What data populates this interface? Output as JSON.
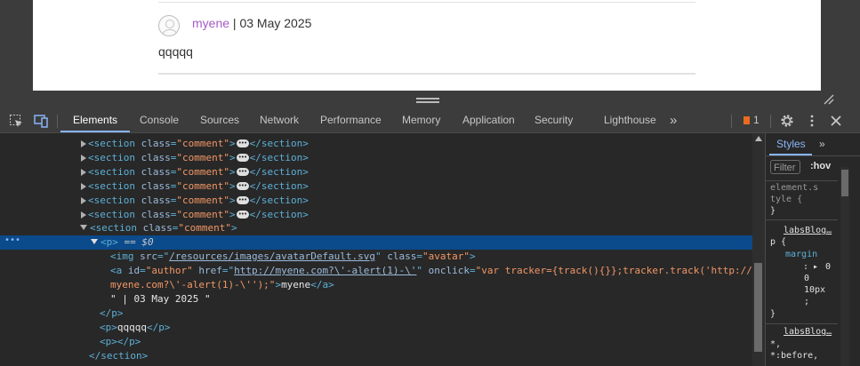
{
  "page": {
    "comment": {
      "author": "myene",
      "separator": " | ",
      "date": "03 May 2025",
      "text": "qqqqq"
    }
  },
  "devtools": {
    "tabs": [
      {
        "label": "Elements",
        "active": true
      },
      {
        "label": "Console"
      },
      {
        "label": "Sources"
      },
      {
        "label": "Network"
      },
      {
        "label": "Performance"
      },
      {
        "label": "Memory"
      },
      {
        "label": "Application"
      },
      {
        "label": "Security"
      },
      {
        "label": "Lighthouse"
      }
    ],
    "more_tabs": "»",
    "issues_count": "1",
    "dom": {
      "section_tag": "section",
      "class_attr": "class",
      "class_value": "\"comment\"",
      "p_tag": "p",
      "selected_suffix": " == $0",
      "img_tag": "img",
      "img_src_attr": "src",
      "img_src": "/resources/images/avatarDefault.svg",
      "img_class_attr": "class",
      "img_class": "\"avatar\"",
      "a_tag": "a",
      "a_id_attr": "id",
      "a_id": "\"author\"",
      "a_href_attr": "href",
      "a_href": "http://myene.com?\\'-alert(1)-\\'",
      "a_onclick_attr": "onclick",
      "a_onclick": "\"var tracker={track(){}};tracker.track('http://",
      "a_onclick_cont": "myene.com?\\'-alert(1)-\\'');\"",
      "a_text": "myene",
      "date_text": "\" | 03 May 2025 \"",
      "p2_text": "qqqqq"
    },
    "styles": {
      "tab": "Styles",
      "more": "»",
      "filter_placeholder": "Filter",
      "hov": ":hov",
      "element_style_1": "element.s",
      "element_style_2": "tyle {",
      "close_brace": "}",
      "source_1": "labsBlog…",
      "selector_1": "p {",
      "prop_name": "margin",
      "prop_colon": ":",
      "prop_val_1": "0",
      "prop_val_2": "0",
      "prop_val_3": "10px",
      "prop_semicolon": ";",
      "source_2": "labsBlog…",
      "selector_2a": "*,",
      "selector_2b": "*:before,"
    }
  }
}
